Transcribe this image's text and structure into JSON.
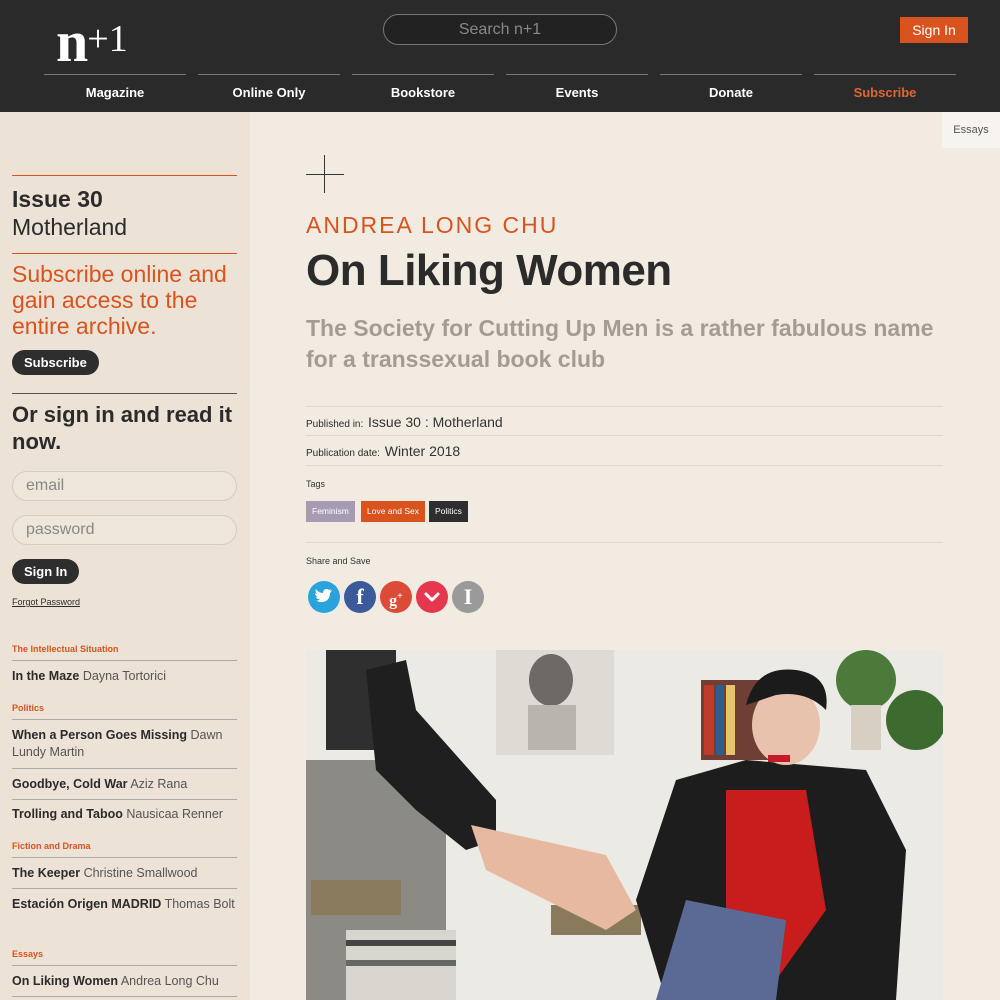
{
  "header": {
    "logo_main": "n",
    "logo_plus": "+1",
    "search_placeholder": "Search n+1",
    "signin_label": "Sign In",
    "nav": [
      "Magazine",
      "Online Only",
      "Bookstore",
      "Events",
      "Donate",
      "Subscribe"
    ]
  },
  "sidebar": {
    "issue_number": "Issue 30",
    "issue_name": "Motherland",
    "promo": "Subscribe online and gain access to the entire archive.",
    "subscribe_label": "Subscribe",
    "or_sign_in": "Or sign in and read it now.",
    "email_placeholder": "email",
    "password_placeholder": "password",
    "signin_label": "Sign In",
    "forgot_label": "Forgot Password",
    "sections": [
      {
        "label": "The Intellectual Situation",
        "items": [
          {
            "title": "In the Maze",
            "author": "Dayna Tortorici"
          }
        ]
      },
      {
        "label": "Politics",
        "items": [
          {
            "title": "When a Person Goes Missing",
            "author": "Dawn Lundy Martin"
          },
          {
            "title": "Goodbye, Cold War",
            "author": "Aziz Rana"
          },
          {
            "title": "Trolling and Taboo",
            "author": "Nausicaa Renner"
          }
        ]
      },
      {
        "label": "Fiction and Drama",
        "items": [
          {
            "title": "The Keeper",
            "author": "Christine Smallwood"
          },
          {
            "title": "Estación Origen MADRID",
            "author": "Thomas Bolt"
          }
        ]
      },
      {
        "label": "Essays",
        "items": [
          {
            "title": "On Liking Women",
            "author": "Andrea Long Chu"
          }
        ]
      }
    ]
  },
  "article": {
    "category_tab": "Essays",
    "author": "ANDREA LONG CHU",
    "title": "On Liking Women",
    "subtitle": "The Society for Cutting Up Men is a rather fabulous name for a transsexual book club",
    "published_label": "Published in:",
    "published_value": "Issue 30 : Motherland",
    "date_label": "Publication date:",
    "date_value": "Winter 2018",
    "tags_label": "Tags",
    "tags": [
      "Feminism",
      "Love and Sex",
      "Politics"
    ],
    "share_label": "Share and Save",
    "share_icons": [
      "twitter-icon",
      "facebook-icon",
      "google-plus-icon",
      "pocket-icon",
      "instapaper-icon"
    ]
  },
  "colors": {
    "accent": "#d8531d",
    "header_bg": "#2a2a2a",
    "page_bg": "#f1ebe2",
    "sidebar_bg": "#ece2d6",
    "tag_feminism": "#a79bb4",
    "tag_love": "#d8531d",
    "tag_politics": "#2e2e2e"
  }
}
